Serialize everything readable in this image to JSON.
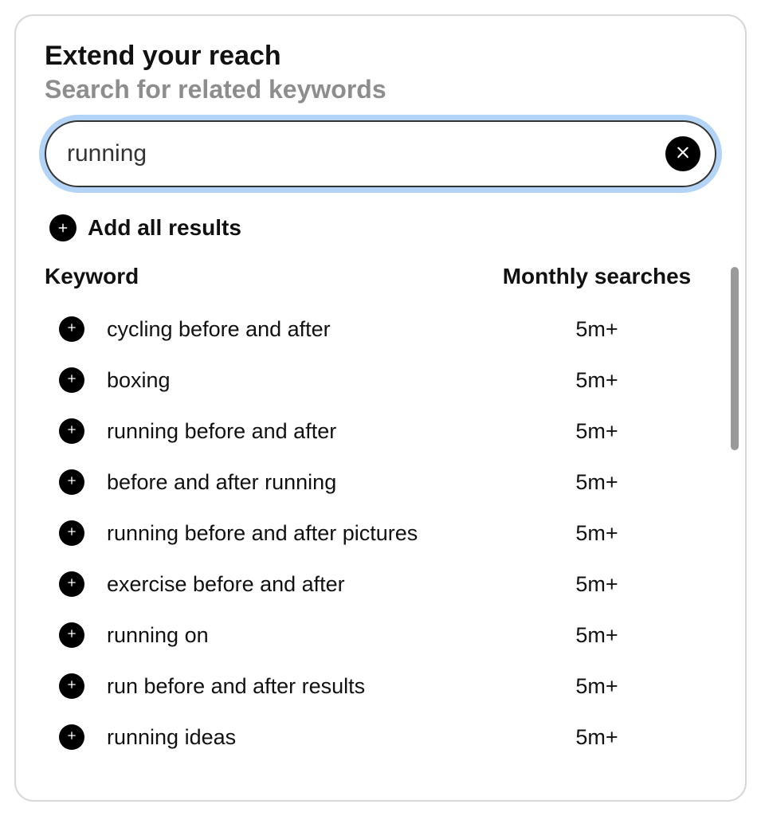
{
  "header": {
    "title": "Extend your reach",
    "subtitle": "Search for related keywords"
  },
  "search": {
    "value": "running ",
    "placeholder": ""
  },
  "add_all": {
    "label": "Add all results"
  },
  "table": {
    "headers": {
      "keyword": "Keyword",
      "monthly_searches": "Monthly searches"
    },
    "rows": [
      {
        "keyword": "cycling before and after",
        "searches": "5m+"
      },
      {
        "keyword": "boxing",
        "searches": "5m+"
      },
      {
        "keyword": "running before and after",
        "searches": "5m+"
      },
      {
        "keyword": "before and after running",
        "searches": "5m+"
      },
      {
        "keyword": "running before and after pictures",
        "searches": "5m+"
      },
      {
        "keyword": "exercise before and after",
        "searches": "5m+"
      },
      {
        "keyword": "running on",
        "searches": "5m+"
      },
      {
        "keyword": "run before and after results",
        "searches": "5m+"
      },
      {
        "keyword": "running ideas",
        "searches": "5m+"
      }
    ]
  }
}
